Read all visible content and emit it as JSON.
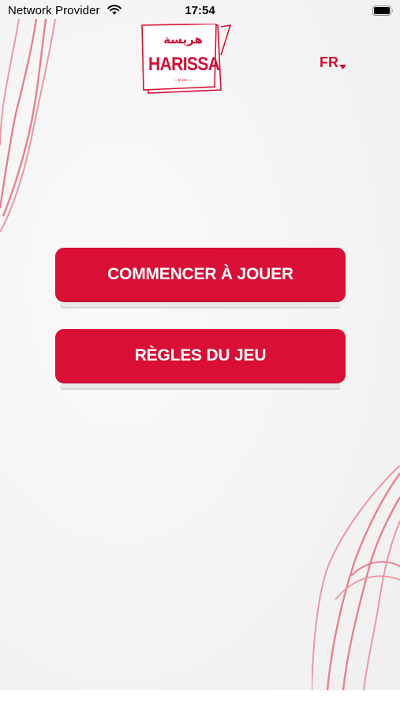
{
  "status_bar": {
    "carrier": "Network Provider",
    "time": "17:54",
    "wifi_icon": "wifi-icon",
    "battery_icon": "battery-icon"
  },
  "logo": {
    "arabic": "هريسة",
    "name": "HARISSA",
    "subtitle": "— le jeu —"
  },
  "language": {
    "selected": "FR",
    "icon": "chevron-down-icon"
  },
  "menu": {
    "start_label": "COMMENCER À JOUER",
    "rules_label": "RÈGLES DU JEU"
  },
  "colors": {
    "brand_red": "#d90f35",
    "decoration_line": "#e8808f",
    "background": "#f5f5f5"
  }
}
